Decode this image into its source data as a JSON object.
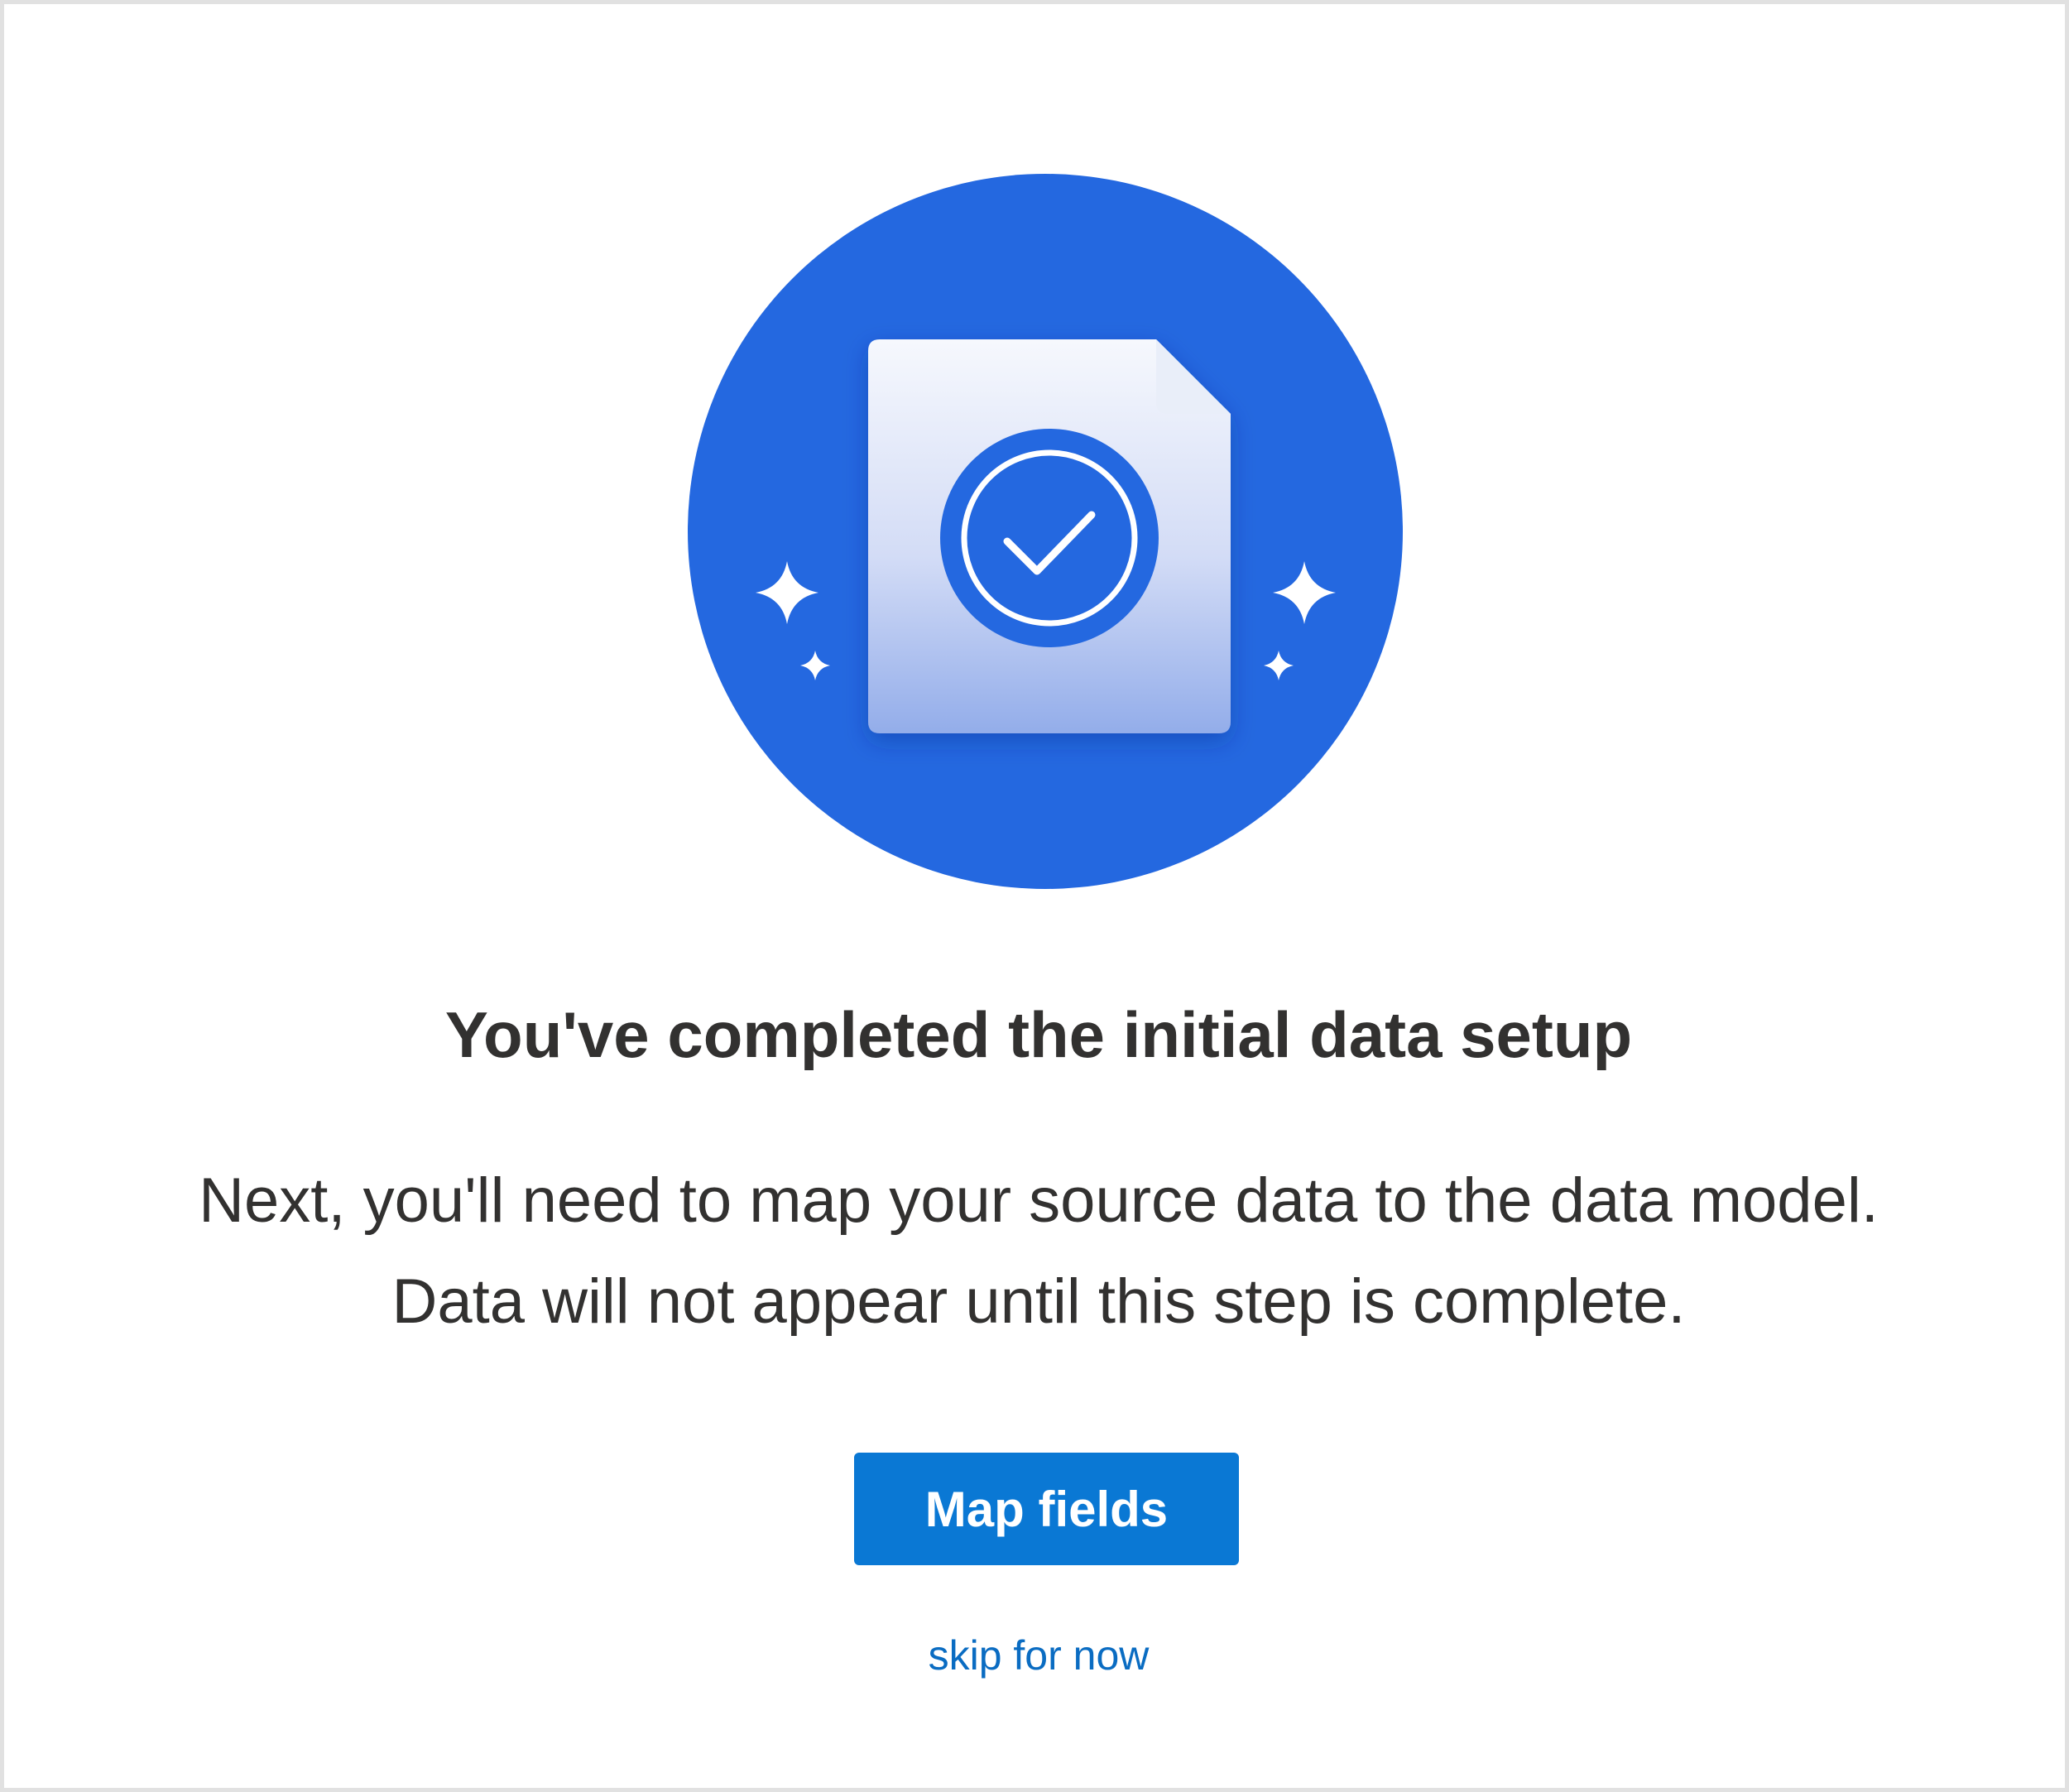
{
  "dialog": {
    "title": "You've completed the initial data setup",
    "message_line_1": "Next, you'll need to map your source data to the data model.",
    "message_line_2": "Data will not appear until this step is complete.",
    "primary_button_label": "Map fields",
    "skip_link_label": "skip for now"
  },
  "illustration": {
    "icon": "document-check-icon",
    "decorations": "sparkle-icon"
  },
  "colors": {
    "circle": "#2468e0",
    "primary_button": "#0a78d4",
    "link": "#0a6cc2",
    "text": "#323130",
    "border": "#e1e1e1"
  }
}
